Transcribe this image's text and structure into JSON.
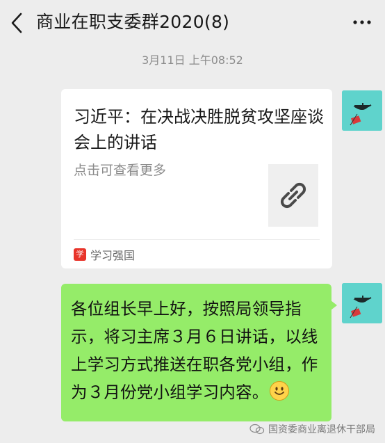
{
  "header": {
    "title": "商业在职支委群2020(8)",
    "back_icon": "chevron-left-icon",
    "more_icon": "more-dots-icon"
  },
  "chat": {
    "timestamp": "3月11日 上午08:52",
    "link_card": {
      "title": "习近平：在决战决胜脱贫攻坚座谈会上的讲话",
      "description": "点击可查看更多",
      "thumbnail_icon": "link-icon",
      "source_name": "学习强国",
      "source_logo_text": "学"
    },
    "message": {
      "text": "各位组长早上好，按照局领导指示，将习主席３月６日讲话，以线上学习方式推送在职各党小组，作为３月份党小组学习内容。",
      "emoji": "smiley-emoji"
    },
    "avatar_bg": "#5fd3cc",
    "bubble_color": "#95ec69"
  },
  "watermark": {
    "text": "国资委商业离退休干部局"
  }
}
